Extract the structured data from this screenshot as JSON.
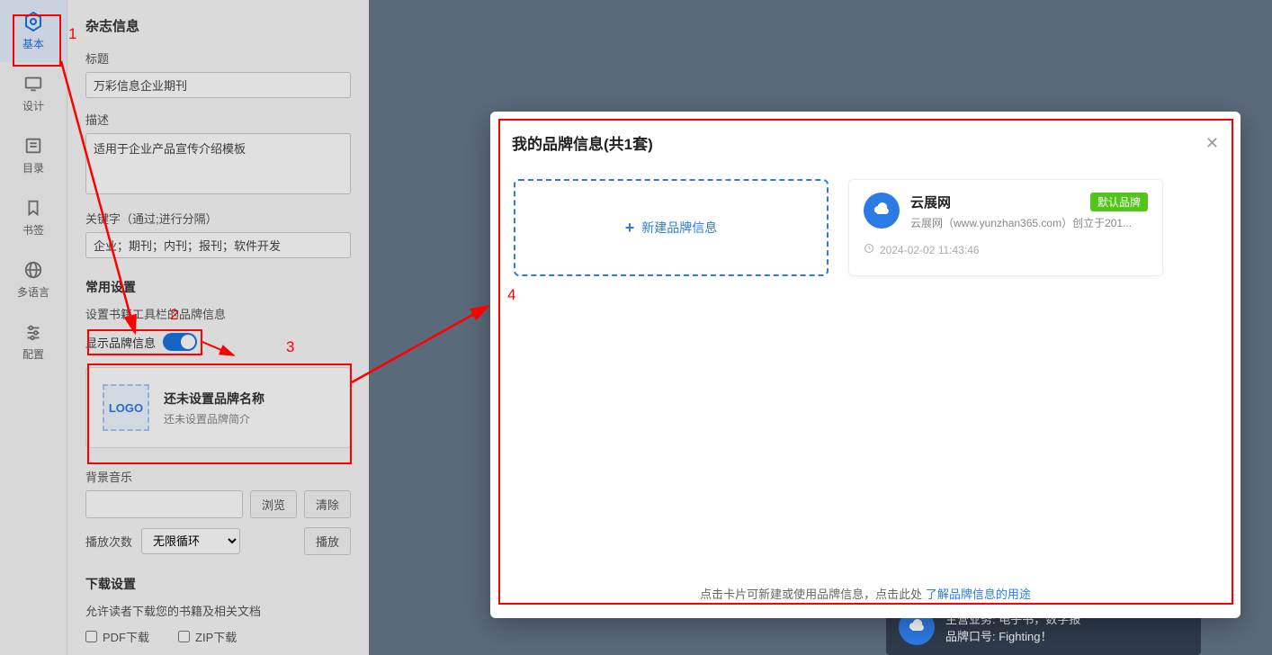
{
  "nav": {
    "basic": "基本",
    "design": "设计",
    "toc": "目录",
    "bookmark": "书签",
    "lang": "多语言",
    "config": "配置"
  },
  "panel": {
    "title": "杂志信息",
    "title_label": "标题",
    "title_value": "万彩信息企业期刊",
    "desc_label": "描述",
    "desc_value": "适用于企业产品宣传介绍模板",
    "keywords_label": "关键字（通过;进行分隔）",
    "keywords_value": "企业；期刊；内刊；报刊；软件开发",
    "common_section": "常用设置",
    "brand_help": "设置书籍工具栏的品牌信息",
    "show_brand_label": "显示品牌信息",
    "brand_card_title": "还未设置品牌名称",
    "brand_card_sub": "还未设置品牌简介",
    "logo_text": "LOGO",
    "bgm_label": "背景音乐",
    "browse": "浏览",
    "clear": "清除",
    "play_count_label": "播放次数",
    "play_count_value": "无限循环",
    "play_btn": "播放",
    "download_section": "下载设置",
    "download_sub": "允许读者下载您的书籍及相关文档",
    "pdf_dl": "PDF下载",
    "zip_dl": "ZIP下载"
  },
  "modal": {
    "title": "我的品牌信息(共1套)",
    "add_label": "新建品牌信息",
    "footer_text": "点击卡片可新建或使用品牌信息，点击此处",
    "footer_link": "了解品牌信息的用途"
  },
  "brand": {
    "name": "云展网",
    "badge": "默认品牌",
    "desc": "云展网（www.yunzhan365.com）创立于201...",
    "time": "2024-02-02 11:43:46"
  },
  "bgcard": {
    "line1": "主营业务: 电子书，数字报",
    "line2": "品牌口号: Fighting！"
  },
  "anno": {
    "1": "1",
    "2": "2",
    "3": "3",
    "4": "4"
  }
}
